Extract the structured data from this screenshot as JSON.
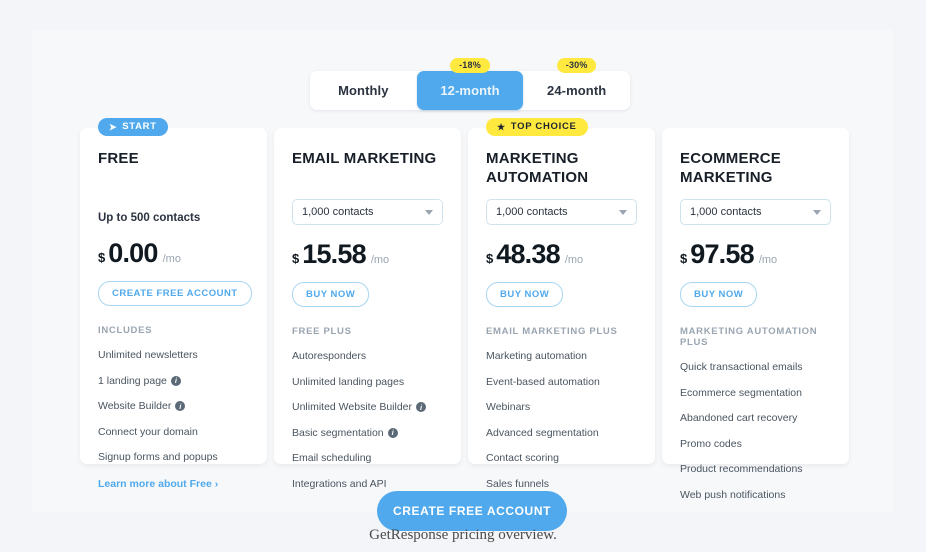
{
  "billing_toggle": {
    "options": [
      {
        "label": "Monthly",
        "discount": null,
        "active": false
      },
      {
        "label": "12-month",
        "discount": "-18%",
        "active": true
      },
      {
        "label": "24-month",
        "discount": "-30%",
        "active": false
      }
    ]
  },
  "plans": [
    {
      "badge": {
        "text": "START",
        "glyph": "➤",
        "style": "start"
      },
      "title": "FREE",
      "contacts_note": "Up to 500 contacts",
      "select": null,
      "currency": "$",
      "price": "0.00",
      "period": "/mo",
      "cta": "CREATE FREE ACCOUNT",
      "includes_label": "INCLUDES",
      "features": [
        {
          "text": "Unlimited newsletters",
          "info": false
        },
        {
          "text": "1 landing page",
          "info": true
        },
        {
          "text": "Website Builder",
          "info": true
        },
        {
          "text": "Connect your domain",
          "info": false
        },
        {
          "text": "Signup forms and popups",
          "info": false
        }
      ],
      "learn_more": "Learn more about Free ›"
    },
    {
      "badge": null,
      "title": "EMAIL MARKETING",
      "contacts_note": null,
      "select": "1,000 contacts",
      "currency": "$",
      "price": "15.58",
      "period": "/mo",
      "cta": "BUY NOW",
      "includes_label": "FREE PLUS",
      "features": [
        {
          "text": "Autoresponders",
          "info": false
        },
        {
          "text": "Unlimited landing pages",
          "info": false
        },
        {
          "text": "Unlimited Website Builder",
          "info": true
        },
        {
          "text": "Basic segmentation",
          "info": true
        },
        {
          "text": "Email scheduling",
          "info": false
        },
        {
          "text": "Integrations and API",
          "info": false
        }
      ],
      "learn_more": null
    },
    {
      "badge": {
        "text": "TOP CHOICE",
        "glyph": "★",
        "style": "top"
      },
      "title": "MARKETING AUTOMATION",
      "contacts_note": null,
      "select": "1,000 contacts",
      "currency": "$",
      "price": "48.38",
      "period": "/mo",
      "cta": "BUY NOW",
      "includes_label": "EMAIL MARKETING PLUS",
      "features": [
        {
          "text": "Marketing automation",
          "info": false
        },
        {
          "text": "Event-based automation",
          "info": false
        },
        {
          "text": "Webinars",
          "info": false
        },
        {
          "text": "Advanced segmentation",
          "info": false
        },
        {
          "text": "Contact scoring",
          "info": false
        },
        {
          "text": "Sales funnels",
          "info": false
        }
      ],
      "learn_more": null
    },
    {
      "badge": null,
      "title": "ECOMMERCE MARKETING",
      "contacts_note": null,
      "select": "1,000 contacts",
      "currency": "$",
      "price": "97.58",
      "period": "/mo",
      "cta": "BUY NOW",
      "includes_label": "MARKETING AUTOMATION PLUS",
      "features": [
        {
          "text": "Quick transactional emails",
          "info": false
        },
        {
          "text": "Ecommerce segmentation",
          "info": false
        },
        {
          "text": "Abandoned cart recovery",
          "info": false
        },
        {
          "text": "Promo codes",
          "info": false
        },
        {
          "text": "Product recommendations",
          "info": false
        },
        {
          "text": "Web push notifications",
          "info": false
        }
      ],
      "learn_more": null
    }
  ],
  "bottom_cta": {
    "label": "CREATE FREE ACCOUNT"
  },
  "caption": {
    "text": "GetResponse pricing overview."
  },
  "colors": {
    "accent_blue": "#4fa9ec",
    "badge_yellow": "#ffe93f",
    "page_background": "#f4f5f9",
    "panel_background": "#f7f8fa",
    "card_background": "#ffffff"
  }
}
